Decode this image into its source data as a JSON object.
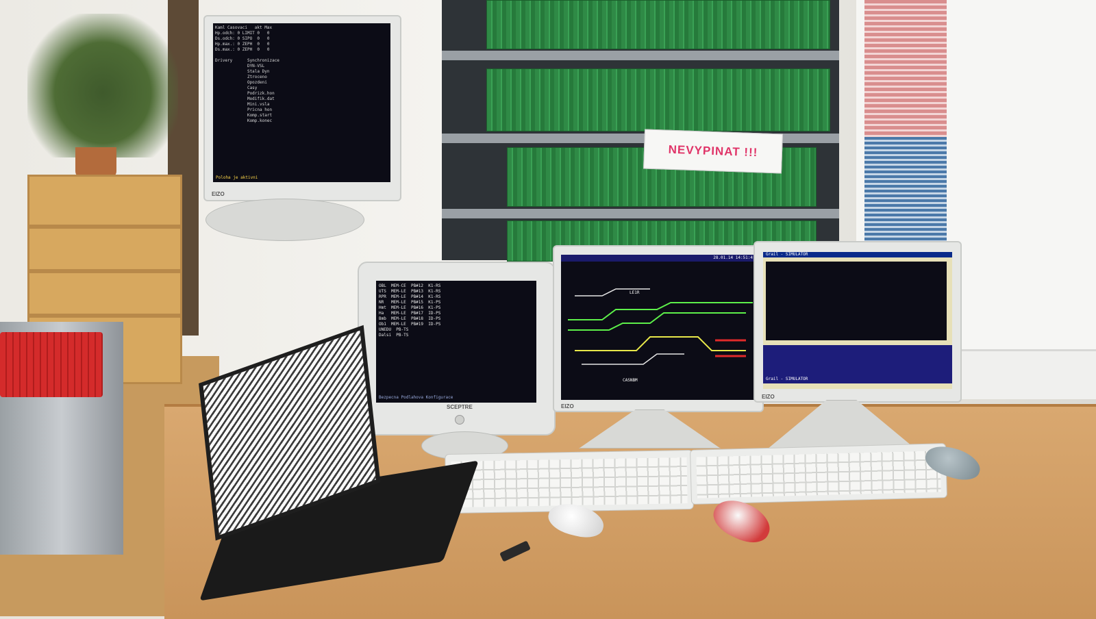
{
  "scene": {
    "description_tags": [
      "railway-signalling-workstation"
    ]
  },
  "warning_sign": {
    "text": "NEVYPINAT !!!"
  },
  "monitor_left_top": {
    "logo": "EIZO",
    "status_text": "Poloha je aktivni",
    "lines": [
      "Kaml Casovaci   akt Max",
      "Hp.odch: 0 LIMIT 0   0",
      "Ds.odch: 0 SIPO  0   0",
      "Hp.max.: 0 ZEPH  0   0",
      "Ds.max.: 0 ZEPH  0   0",
      "                     ",
      "Drivery      Synchronizace",
      "             DYN-VSL",
      "             Stala Dyn",
      "             Ztroceno",
      "             Opozdeni",
      "             Casy",
      "             Podrizk.hon",
      "             Modifik.dat",
      "             Mini.vsla",
      "             Pricna hon",
      "             Komp.start",
      "             Komp.konec"
    ]
  },
  "monitor_crt": {
    "logo": "SCEPTRE",
    "lines": [
      "OBL  MEM-CE  PB#12  K1-RS",
      "UTS  MEM-LE  PB#13  K1-RS",
      "RPR  MEM-LE  PB#14  K1-RS",
      "NR   MEM-LE  PB#15  K1-PS",
      "Hmt  MEM-LE  PB#16  K1-PS",
      "Ha   MEM-LE  PB#17  ID-PS",
      "Bmb  MEM-LE  PB#18  ID-PS",
      "Ob1  MEM-LE  PB#19  ID-PS",
      "UNEDU  PB-TS",
      "Dalsi  PB-TS"
    ],
    "footer": "Bezpecna Podlahova Konfigurace"
  },
  "monitor_center": {
    "logo": "EIZO",
    "header_time": "28.01.14 14:51:4",
    "label_station": "LE1R",
    "label_bottom": "CASNBM"
  },
  "monitor_right": {
    "logo": "EIZO",
    "title": "Grail - SIMULATOR",
    "bottom_title": "Grail - SIMULATOR"
  },
  "colors": {
    "track_green": "#5df04a",
    "track_yellow": "#e8e84a",
    "track_red": "#e02a2a",
    "track_white": "#e6e6e6",
    "screen_bg": "#0c0c16",
    "sign_text": "#e03468"
  }
}
